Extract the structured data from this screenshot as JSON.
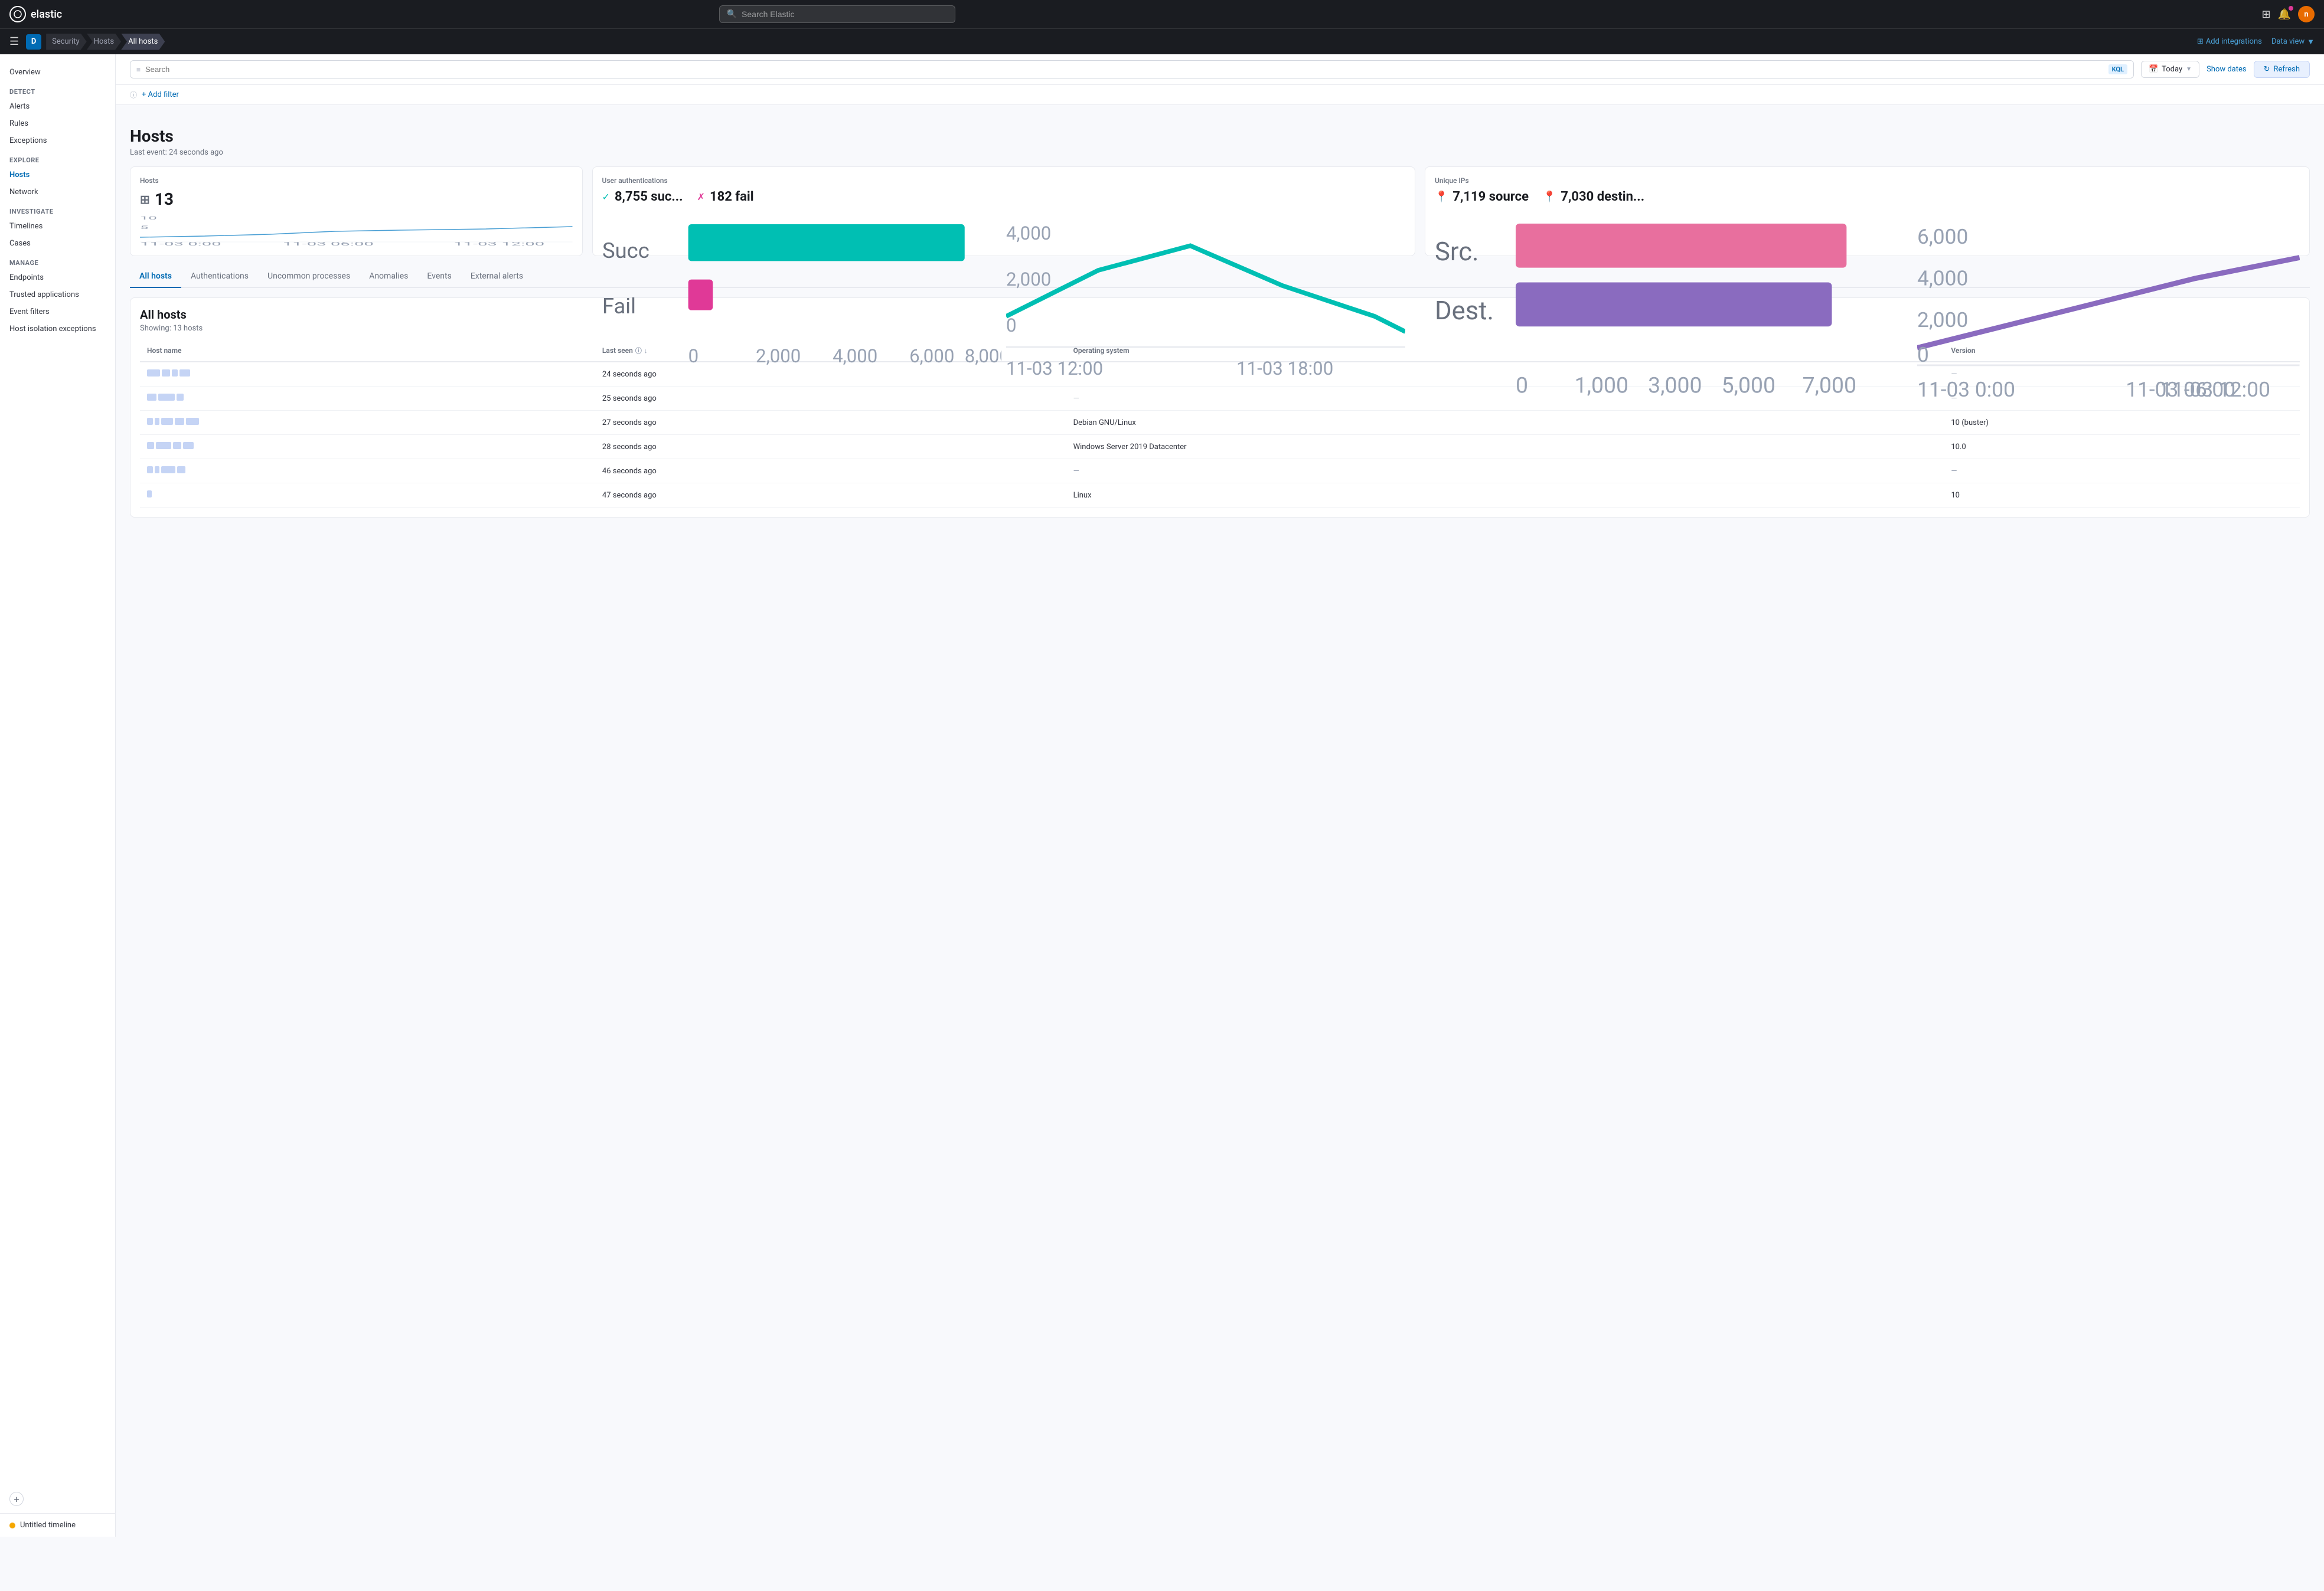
{
  "app": {
    "name": "elastic",
    "logo_text": "elastic",
    "search_placeholder": "Search Elastic"
  },
  "breadcrumb": {
    "app_key": "D",
    "items": [
      {
        "label": "Security",
        "active": false
      },
      {
        "label": "Hosts",
        "active": false
      },
      {
        "label": "All hosts",
        "active": true
      }
    ],
    "add_integrations": "Add integrations",
    "data_view": "Data view"
  },
  "filter_bar": {
    "search_placeholder": "Search",
    "kql_label": "KQL",
    "date_label": "Today",
    "show_dates": "Show dates",
    "refresh": "Refresh",
    "add_filter": "+ Add filter"
  },
  "page": {
    "title": "Hosts",
    "subtitle": "Last event: 24 seconds ago"
  },
  "stat_cards": {
    "hosts": {
      "title": "Hosts",
      "value": "13"
    },
    "user_auth": {
      "title": "User authentications",
      "success_value": "8,755 suc...",
      "fail_value": "182 fail"
    },
    "unique_ips": {
      "title": "Unique IPs",
      "source_value": "7,119 source",
      "dest_value": "7,030 destin..."
    }
  },
  "tabs": [
    {
      "label": "All hosts",
      "active": true
    },
    {
      "label": "Authentications",
      "active": false
    },
    {
      "label": "Uncommon processes",
      "active": false
    },
    {
      "label": "Anomalies",
      "active": false
    },
    {
      "label": "Events",
      "active": false
    },
    {
      "label": "External alerts",
      "active": false
    }
  ],
  "all_hosts": {
    "title": "All hosts",
    "count": "Showing: 13 hosts",
    "columns": [
      {
        "label": "Host name"
      },
      {
        "label": "Last seen",
        "sortable": true
      },
      {
        "label": "Operating system"
      },
      {
        "label": "Version"
      }
    ],
    "rows": [
      {
        "name_blocks": [
          22,
          14,
          10,
          18
        ],
        "last_seen": "24 seconds ago",
        "os": "—",
        "version": "—"
      },
      {
        "name_blocks": [
          16,
          28,
          12
        ],
        "last_seen": "25 seconds ago",
        "os": "—",
        "version": "—"
      },
      {
        "name_blocks": [
          10,
          8,
          20,
          16,
          22
        ],
        "last_seen": "27 seconds ago",
        "os": "Debian GNU/Linux",
        "version": "10 (buster)"
      },
      {
        "name_blocks": [
          12,
          26,
          14,
          18
        ],
        "last_seen": "28 seconds ago",
        "os": "Windows Server 2019 Datacenter",
        "version": "10.0"
      },
      {
        "name_blocks": [
          10,
          8,
          24,
          14
        ],
        "last_seen": "46 seconds ago",
        "os": "—",
        "version": "—"
      },
      {
        "name_blocks": [
          8
        ],
        "last_seen": "47 seconds ago",
        "os": "Linux",
        "version": "10"
      }
    ]
  },
  "sidebar": {
    "title": "Security",
    "sections": [
      {
        "items": [
          {
            "label": "Overview",
            "active": false
          }
        ]
      },
      {
        "label": "Detect",
        "items": [
          {
            "label": "Alerts",
            "active": false
          },
          {
            "label": "Rules",
            "active": false
          },
          {
            "label": "Exceptions",
            "active": false
          }
        ]
      },
      {
        "label": "Explore",
        "items": [
          {
            "label": "Hosts",
            "active": true
          },
          {
            "label": "Network",
            "active": false
          }
        ]
      },
      {
        "label": "Investigate",
        "items": [
          {
            "label": "Timelines",
            "active": false
          },
          {
            "label": "Cases",
            "active": false
          }
        ]
      },
      {
        "label": "Manage",
        "items": [
          {
            "label": "Endpoints",
            "active": false
          },
          {
            "label": "Trusted applications",
            "active": false
          },
          {
            "label": "Event filters",
            "active": false
          },
          {
            "label": "Host isolation exceptions",
            "active": false
          }
        ]
      }
    ],
    "timeline_label": "Untitled timeline"
  },
  "colors": {
    "brand_blue": "#006bb4",
    "success_teal": "#00bfb3",
    "fail_pink": "#e03997",
    "source_pink": "#e86f9e",
    "dest_purple": "#8a6bbf",
    "hosts_line": "#4a9fd4",
    "bar_green": "#00bfb3",
    "bar_red": "#e03997",
    "line_teal": "#00bfb3"
  }
}
